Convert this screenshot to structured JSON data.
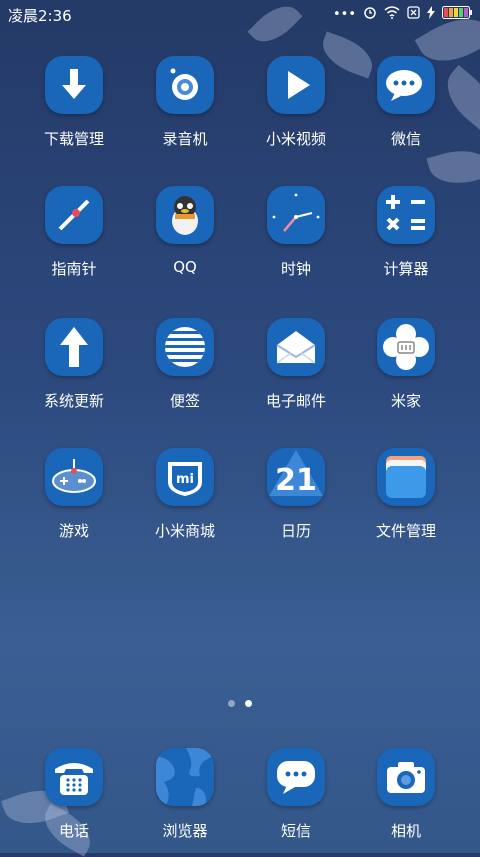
{
  "status_bar": {
    "time": "凌晨2:36",
    "icons": [
      "more-dots-icon",
      "alarm-icon",
      "wifi-icon",
      "sim-disabled-icon",
      "charging-icon",
      "battery-icon"
    ]
  },
  "apps": [
    {
      "name": "下载管理",
      "icon": "download-arrow-icon"
    },
    {
      "name": "录音机",
      "icon": "record-icon"
    },
    {
      "name": "小米视频",
      "icon": "play-icon"
    },
    {
      "name": "微信",
      "icon": "chat-bubble-icon"
    },
    {
      "name": "指南针",
      "icon": "compass-icon"
    },
    {
      "name": "QQ",
      "icon": "penguin-icon"
    },
    {
      "name": "时钟",
      "icon": "clock-icon"
    },
    {
      "name": "计算器",
      "icon": "calculator-icon"
    },
    {
      "name": "系统更新",
      "icon": "update-arrow-icon"
    },
    {
      "name": "便签",
      "icon": "notes-icon"
    },
    {
      "name": "电子邮件",
      "icon": "envelope-icon"
    },
    {
      "name": "米家",
      "icon": "flower-icon"
    },
    {
      "name": "游戏",
      "icon": "gamepad-icon"
    },
    {
      "name": "小米商城",
      "icon": "mi-store-icon"
    },
    {
      "name": "日历",
      "icon": "calendar-icon"
    },
    {
      "name": "文件管理",
      "icon": "folder-icon"
    }
  ],
  "calendar_day": "21",
  "store_badge": "mi",
  "page_indicator": {
    "pages": 2,
    "current": 2
  },
  "dock": [
    {
      "name": "电话",
      "icon": "phone-icon"
    },
    {
      "name": "浏览器",
      "icon": "globe-icon"
    },
    {
      "name": "短信",
      "icon": "message-icon"
    },
    {
      "name": "相机",
      "icon": "camera-icon"
    }
  ]
}
